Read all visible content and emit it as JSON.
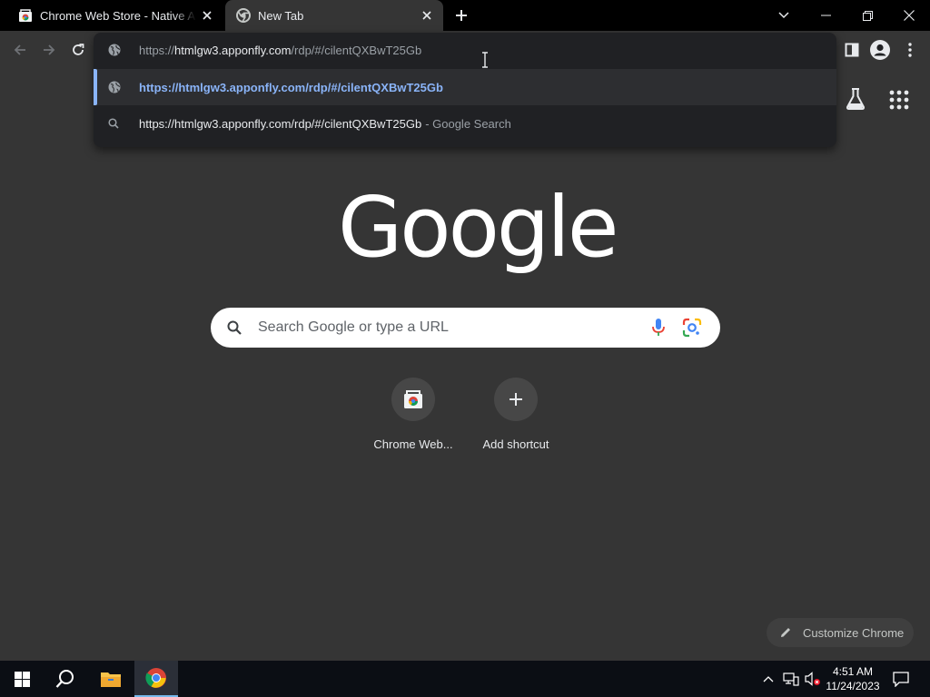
{
  "tabs": [
    {
      "title": "Chrome Web Store - Native American",
      "favicon": "chrome-web-store-icon"
    },
    {
      "title": "New Tab",
      "favicon": "chrome-icon"
    }
  ],
  "omnibox": {
    "url_scheme": "https://",
    "url_host": "htmlgw3.apponfly.com",
    "url_path": "/rdp/#/cilentQXBwT25Gb",
    "suggestions": [
      {
        "text": "https://htmlgw3.apponfly.com/rdp/#/cilentQXBwT25Gb",
        "icon": "globe-icon"
      },
      {
        "text": "https://htmlgw3.apponfly.com/rdp/#/cilentQXBwT25Gb",
        "sub": "- Google Search",
        "icon": "search-icon"
      }
    ]
  },
  "ntp": {
    "logo": "Google",
    "search_placeholder": "Search Google or type a URL",
    "shortcuts": [
      {
        "label": "Chrome Web...",
        "icon": "chrome-web-store-icon"
      },
      {
        "label": "Add shortcut",
        "icon": "plus-icon"
      }
    ],
    "customize_label": "Customize Chrome"
  },
  "taskbar": {
    "time": "4:51 AM",
    "date": "11/24/2023"
  },
  "colors": {
    "background": "#353535",
    "tabstrip": "#000000",
    "omnibox_popup": "#202124",
    "accent_blue": "#8ab4f8",
    "taskbar": "#0b0e14"
  }
}
